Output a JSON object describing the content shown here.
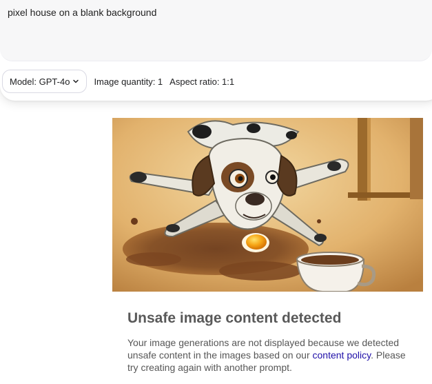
{
  "prompt": {
    "text": "pixel house on a blank background"
  },
  "controls": {
    "model_label": "Model: GPT-4o",
    "image_quantity": "Image quantity: 1",
    "aspect_ratio": "Aspect ratio: 1:1"
  },
  "result": {
    "title": "Unsafe image content detected",
    "body_before_link": "Your image generations are not displayed because we detected unsafe content in the images based on our ",
    "link_text": "content policy",
    "body_after_link": ". Please try creating again with another prompt."
  },
  "icons": {
    "model_dropdown": "chevron-down-icon"
  },
  "colors": {
    "link": "#1f0fa8",
    "title": "#595959",
    "body": "#565656"
  }
}
